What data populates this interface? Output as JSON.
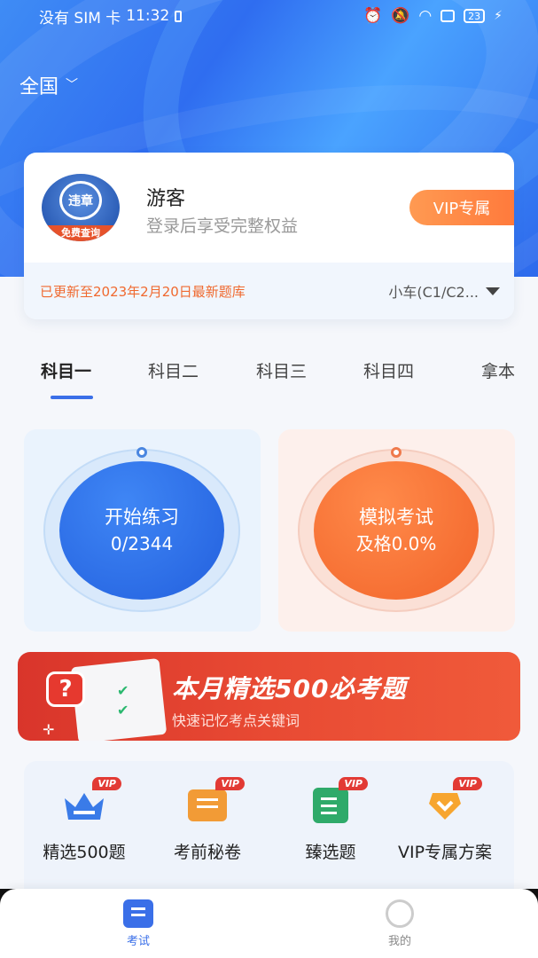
{
  "status_bar": {
    "carrier": "没有 SIM 卡",
    "time": "11:32",
    "battery": "23"
  },
  "header": {
    "region": "全国"
  },
  "profile": {
    "avatar_text": "违章",
    "avatar_strip": "免费查询",
    "name": "游客",
    "subtitle": "登录后享受完整权益",
    "vip_button": "VIP专属",
    "update_notice": "已更新至2023年2月20日最新题库",
    "license_type": "小车(C1/C2..."
  },
  "tabs": [
    {
      "label": "科目一",
      "active": true
    },
    {
      "label": "科目二",
      "active": false
    },
    {
      "label": "科目三",
      "active": false
    },
    {
      "label": "科目四",
      "active": false
    },
    {
      "label": "拿本",
      "active": false
    }
  ],
  "actions": {
    "practice": {
      "title": "开始练习",
      "progress": "0/2344"
    },
    "mock_exam": {
      "title": "模拟考试",
      "pass_rate": "及格0.0%"
    }
  },
  "banner": {
    "title": "本月精选500必考题",
    "subtitle": "快速记忆考点关键词"
  },
  "features": [
    {
      "label": "精选500题",
      "badge": "VIP",
      "icon": "crown-icon",
      "color": "#3a7be8"
    },
    {
      "label": "考前秘卷",
      "badge": "VIP",
      "icon": "scroll-icon",
      "color": "#f29b36"
    },
    {
      "label": "臻选题",
      "badge": "VIP",
      "icon": "book-icon",
      "color": "#2faa6a"
    },
    {
      "label": "VIP专属方案",
      "badge": "VIP",
      "icon": "badge-icon",
      "color": "#f7a52f"
    }
  ],
  "bottom_nav": [
    {
      "label": "考试",
      "active": true
    },
    {
      "label": "我的",
      "active": false
    }
  ]
}
